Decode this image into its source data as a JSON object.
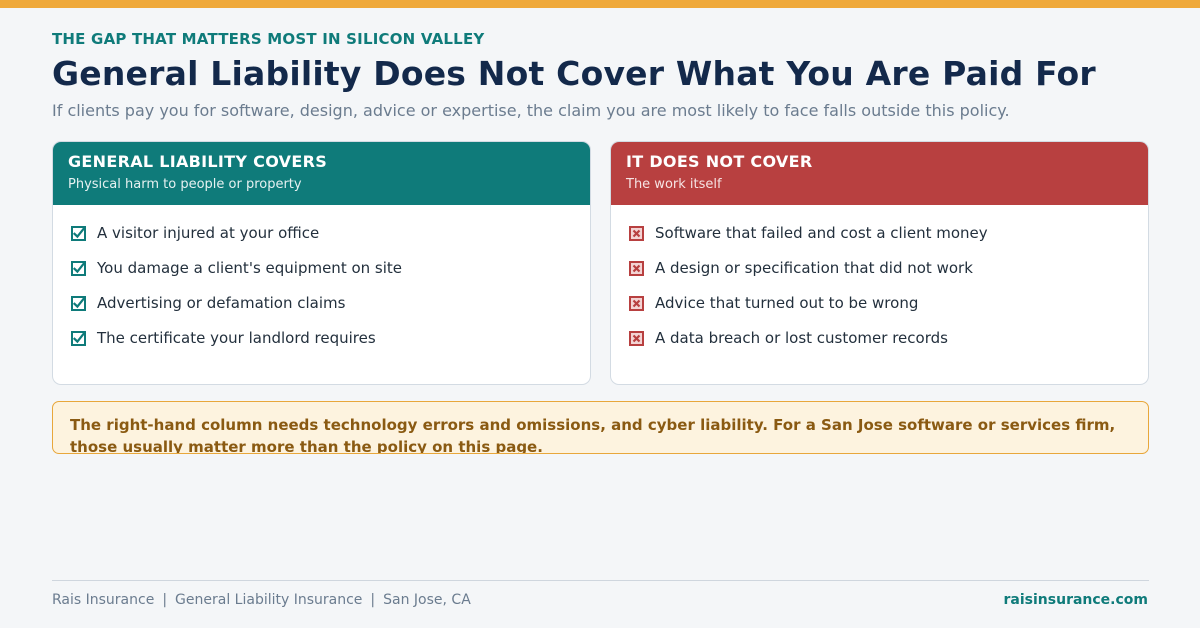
{
  "header": {
    "eyebrow": "THE GAP THAT MATTERS MOST IN SILICON VALLEY",
    "title": "General Liability Does Not Cover What You Are Paid For",
    "subtitle": "If clients pay you for software, design, advice or expertise, the claim you are most likely to face falls outside this policy."
  },
  "covers": {
    "title": "GENERAL LIABILITY COVERS",
    "subtitle": "Physical harm to people or property",
    "icon": "checkbox-checked-icon",
    "items": [
      "A visitor injured at your office",
      "You damage a client's equipment on site",
      "Advertising or defamation claims",
      "The certificate your landlord requires"
    ]
  },
  "not_covered": {
    "title": "IT DOES NOT COVER",
    "subtitle": "The work itself",
    "icon": "checkbox-x-icon",
    "items": [
      "Software that failed and cost a client money",
      "A design or specification that did not work",
      "Advice that turned out to be wrong",
      "A data breach or lost customer records"
    ]
  },
  "note": "The right-hand column needs technology errors and omissions, and cyber liability. For a San Jose software or services firm, those usually matter more than the policy on this page.",
  "footer": {
    "company": "Rais Insurance",
    "product": "General Liability Insurance",
    "location": "San Jose, CA",
    "separator": "|",
    "website": "raisinsurance.com"
  },
  "colors": {
    "accent_top": "#efa93b",
    "teal": "#0f7b7a",
    "red": "#b84040",
    "navy": "#13294b",
    "note_bg": "#fdf3df",
    "note_text": "#8a5a12"
  }
}
